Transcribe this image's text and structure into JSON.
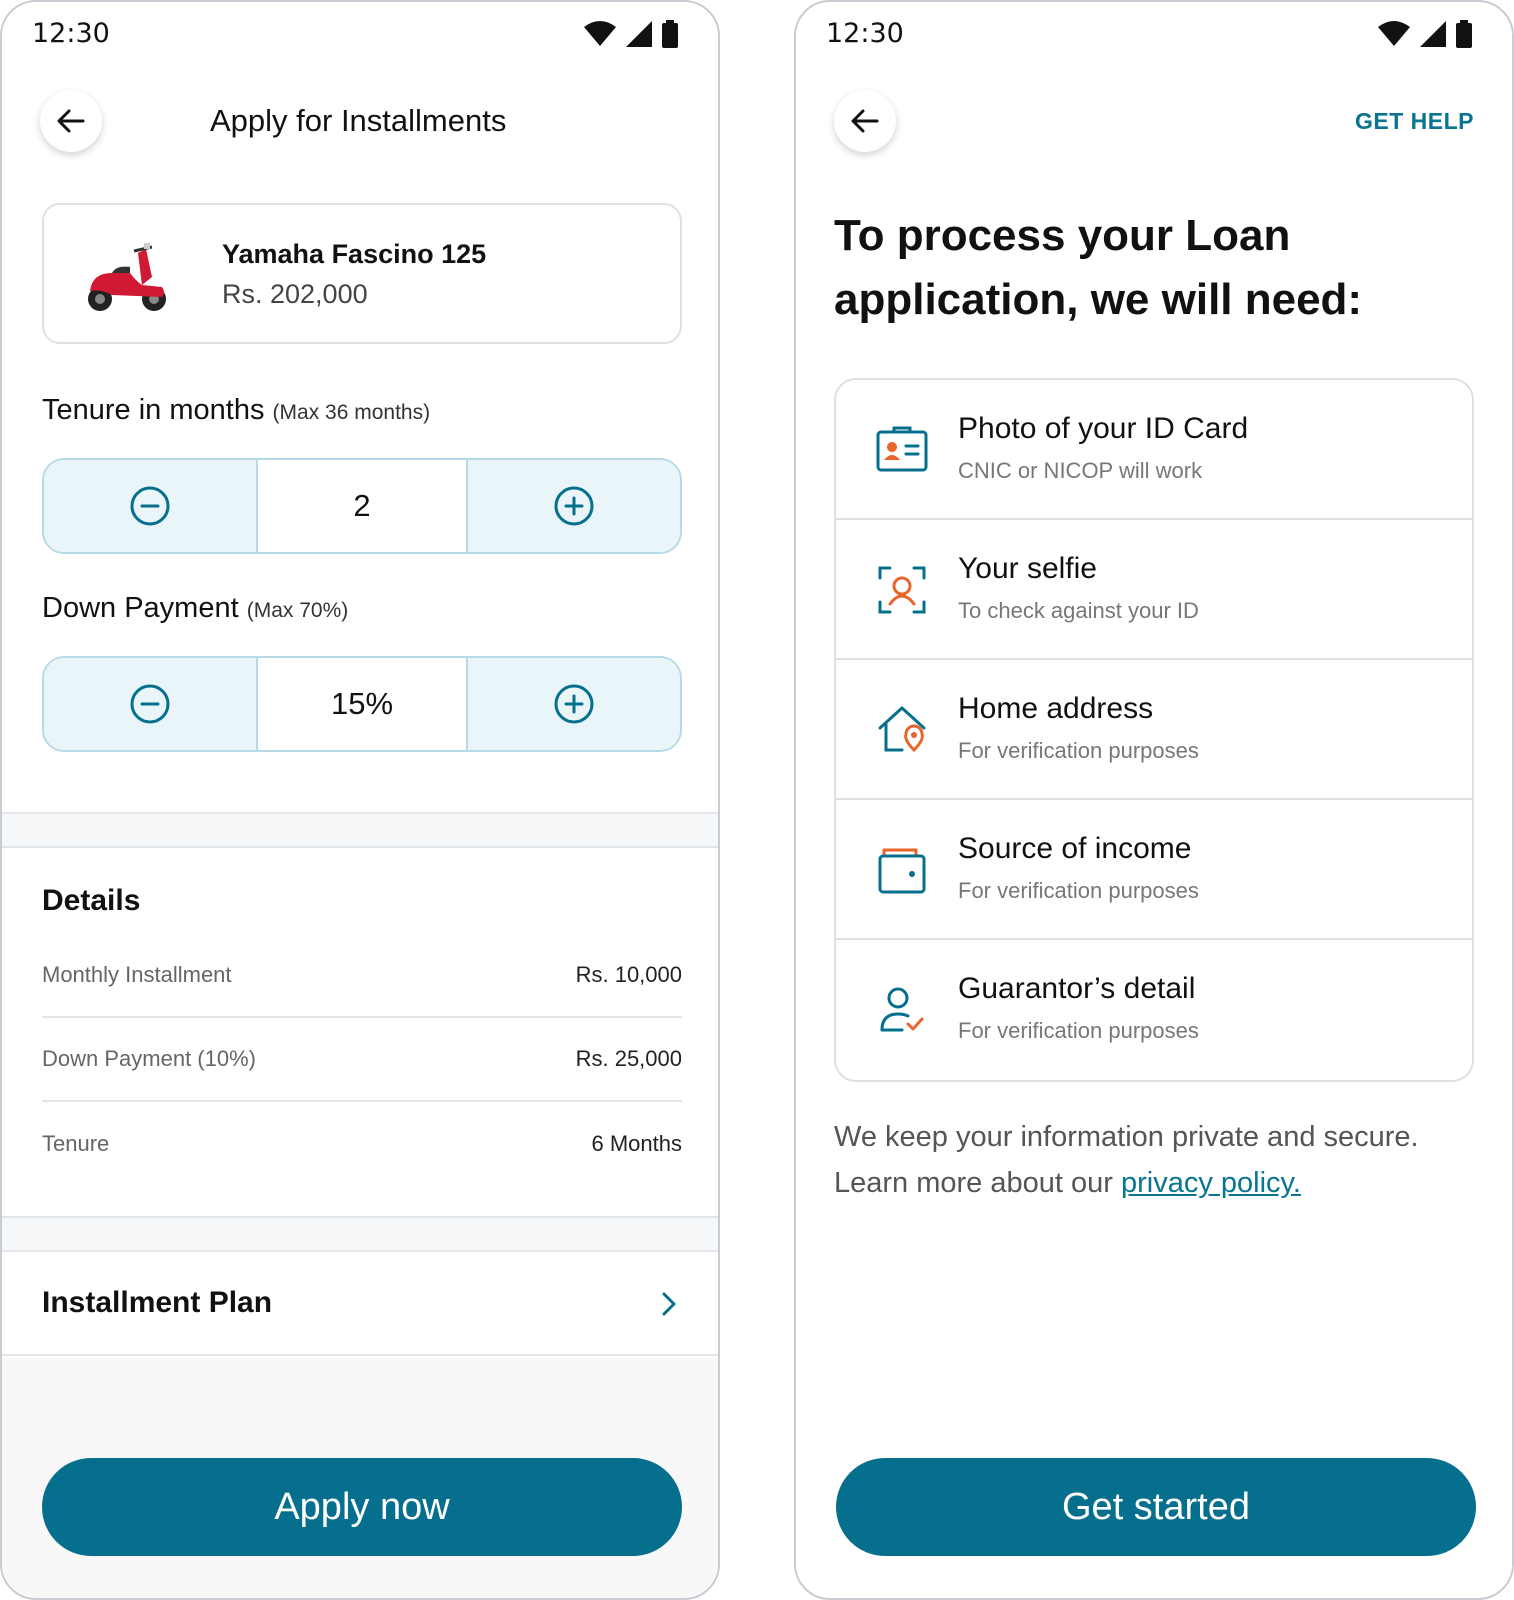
{
  "status_bar": {
    "time": "12:30"
  },
  "left": {
    "title": "Apply for Installments",
    "product": {
      "name": "Yamaha Fascino 125",
      "price": "Rs. 202,000"
    },
    "tenure": {
      "label": "Tenure in months",
      "hint": "(Max 36 months)",
      "value": "2"
    },
    "down_payment": {
      "label": "Down Payment",
      "hint": "(Max 70%)",
      "value": "15%"
    },
    "details": {
      "title": "Details",
      "rows": [
        {
          "label": "Monthly Installment",
          "value": "Rs. 10,000"
        },
        {
          "label": "Down Payment (10%)",
          "value": "Rs. 25,000"
        },
        {
          "label": "Tenure",
          "value": "6 Months"
        }
      ]
    },
    "plan_label": "Installment Plan",
    "apply_label": "Apply now"
  },
  "right": {
    "get_help": "GET HELP",
    "heading": "To process your Loan application, we will need:",
    "requirements": [
      {
        "icon": "id-card-icon",
        "title": "Photo of your ID Card",
        "subtitle": "CNIC or NICOP will work"
      },
      {
        "icon": "selfie-scan-icon",
        "title": "Your selfie",
        "subtitle": "To check against your ID"
      },
      {
        "icon": "home-location-icon",
        "title": "Home address",
        "subtitle": "For verification purposes"
      },
      {
        "icon": "wallet-icon",
        "title": "Source of income",
        "subtitle": "For verification purposes"
      },
      {
        "icon": "user-check-icon",
        "title": "Guarantor’s detail",
        "subtitle": "For verification purposes"
      }
    ],
    "privacy_text": "We keep your information private and secure. Learn more about our ",
    "privacy_link": "privacy policy.",
    "cta_label": "Get started"
  },
  "colors": {
    "primary": "#056f8d",
    "accent": "#e8652b",
    "stepper_bg": "#eaf5f9"
  }
}
